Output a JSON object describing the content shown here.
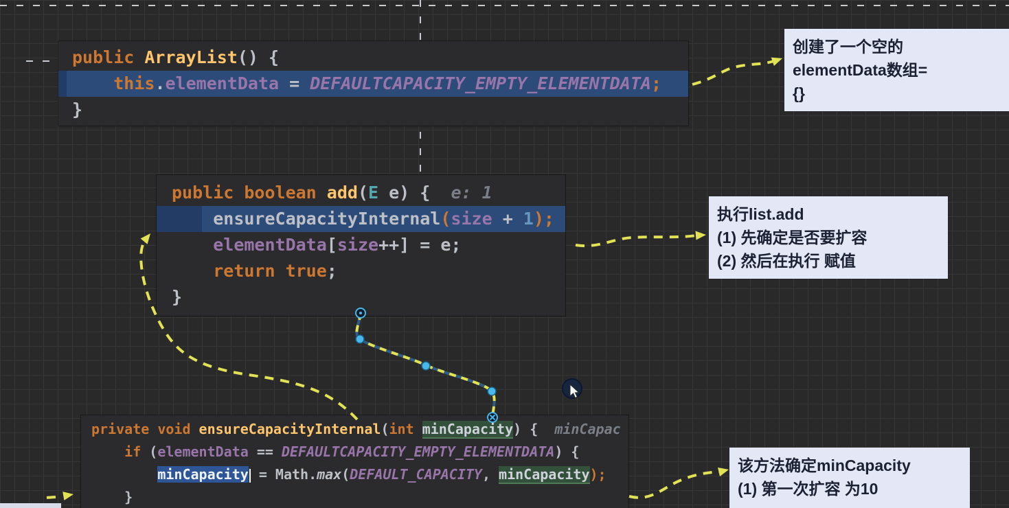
{
  "colors": {
    "canvas_bg": "#29292a",
    "grid_line": "#373738",
    "editor_bg": "#2b2b2d",
    "line_highlight_blue": "#2d4b78",
    "text_selection_blue": "#2e5697",
    "occurrence_green": "#33503b",
    "keyword_orange": "#cc7832",
    "field_purple": "#9876aa",
    "method_yellow": "#ffc66d",
    "arrow_yellow": "#e2e257",
    "handle_cyan": "#49b7ea",
    "note_bg": "#e4e7f5",
    "note_text": "#1b2133"
  },
  "code_blocks": [
    {
      "id": "arraylist-constructor",
      "lines": [
        {
          "segs": [
            {
              "t": "public ",
              "c": "kw"
            },
            {
              "t": "ArrayList",
              "c": "decl"
            },
            {
              "t": "() {",
              "c": "pln"
            }
          ]
        },
        {
          "hl": "hl-a",
          "segs": [
            {
              "t": "    ",
              "c": "pln"
            },
            {
              "t": "this",
              "c": "kw"
            },
            {
              "t": ".",
              "c": "pln"
            },
            {
              "t": "elementData",
              "c": "fld"
            },
            {
              "t": " = ",
              "c": "pln"
            },
            {
              "t": "DEFAULTCAPACITY_EMPTY_ELEMENTDATA",
              "c": "cst"
            },
            {
              "t": ";",
              "c": "orn"
            }
          ]
        },
        {
          "segs": [
            {
              "t": "}",
              "c": "pln"
            }
          ]
        }
      ]
    },
    {
      "id": "add-method",
      "lines": [
        {
          "segs": [
            {
              "t": "public boolean ",
              "c": "kw"
            },
            {
              "t": "add",
              "c": "decl"
            },
            {
              "t": "(",
              "c": "pln"
            },
            {
              "t": "E",
              "c": "typ"
            },
            {
              "t": " e",
              "c": "pln"
            },
            {
              "t": ") {  ",
              "c": "pln"
            },
            {
              "t": "e: 1",
              "c": "hint"
            }
          ]
        },
        {
          "hl": "hl-b",
          "segs": [
            {
              "t": "    ",
              "c": "pln"
            },
            {
              "t": "ensureCapacityInternal",
              "c": "pln"
            },
            {
              "t": "(",
              "c": "orn"
            },
            {
              "t": "size",
              "c": "fld"
            },
            {
              "t": " + ",
              "c": "pln"
            },
            {
              "t": "1",
              "c": "num"
            },
            {
              "t": ");",
              "c": "orn"
            }
          ]
        },
        {
          "segs": [
            {
              "t": "    ",
              "c": "pln"
            },
            {
              "t": "elementData",
              "c": "fld"
            },
            {
              "t": "[",
              "c": "pln"
            },
            {
              "t": "size",
              "c": "fld"
            },
            {
              "t": "++] = e;",
              "c": "pln"
            }
          ]
        },
        {
          "segs": [
            {
              "t": "    ",
              "c": "pln"
            },
            {
              "t": "return true",
              "c": "kw"
            },
            {
              "t": ";",
              "c": "pln"
            }
          ]
        },
        {
          "segs": [
            {
              "t": "}",
              "c": "pln"
            }
          ]
        }
      ]
    },
    {
      "id": "ensure-capacity-internal",
      "lines": [
        {
          "segs": [
            {
              "t": "private void ",
              "c": "kw"
            },
            {
              "t": "ensureCapacityInternal",
              "c": "decl"
            },
            {
              "t": "(",
              "c": "pln"
            },
            {
              "t": "int ",
              "c": "kw"
            },
            {
              "t": "minCapacity",
              "c": "occ"
            },
            {
              "t": ") {  ",
              "c": "pln"
            },
            {
              "t": "minCapac",
              "c": "hint"
            }
          ]
        },
        {
          "segs": [
            {
              "t": "    ",
              "c": "pln"
            },
            {
              "t": "if ",
              "c": "kw"
            },
            {
              "t": "(",
              "c": "pln"
            },
            {
              "t": "elementData",
              "c": "fld"
            },
            {
              "t": " == ",
              "c": "pln"
            },
            {
              "t": "DEFAULTCAPACITY_EMPTY_ELEMENTDATA",
              "c": "cst"
            },
            {
              "t": ") {",
              "c": "pln"
            }
          ]
        },
        {
          "segs": [
            {
              "t": "        ",
              "c": "pln"
            },
            {
              "t": "minCapacity",
              "c": "sel",
              "caret": true
            },
            {
              "t": " = ",
              "c": "pln"
            },
            {
              "t": "Math.",
              "c": "pln"
            },
            {
              "t": "max",
              "c": "ital"
            },
            {
              "t": "(",
              "c": "pln"
            },
            {
              "t": "DEFAULT_CAPACITY",
              "c": "cst"
            },
            {
              "t": ", ",
              "c": "pln"
            },
            {
              "t": "minCapacity",
              "c": "occ"
            },
            {
              "t": ");",
              "c": "orn"
            }
          ]
        },
        {
          "segs": [
            {
              "t": "    }",
              "c": "pln"
            }
          ]
        }
      ]
    }
  ],
  "notes": [
    {
      "lines": [
        "创建了一个空的",
        "elementData数组=",
        "{}"
      ]
    },
    {
      "lines": [
        "执行list.add",
        "(1) 先确定是否要扩容",
        "(2) 然后在执行 赋值"
      ]
    },
    {
      "lines": [
        "该方法确定minCapacity",
        "(1) 第一次扩容 为10"
      ]
    }
  ]
}
